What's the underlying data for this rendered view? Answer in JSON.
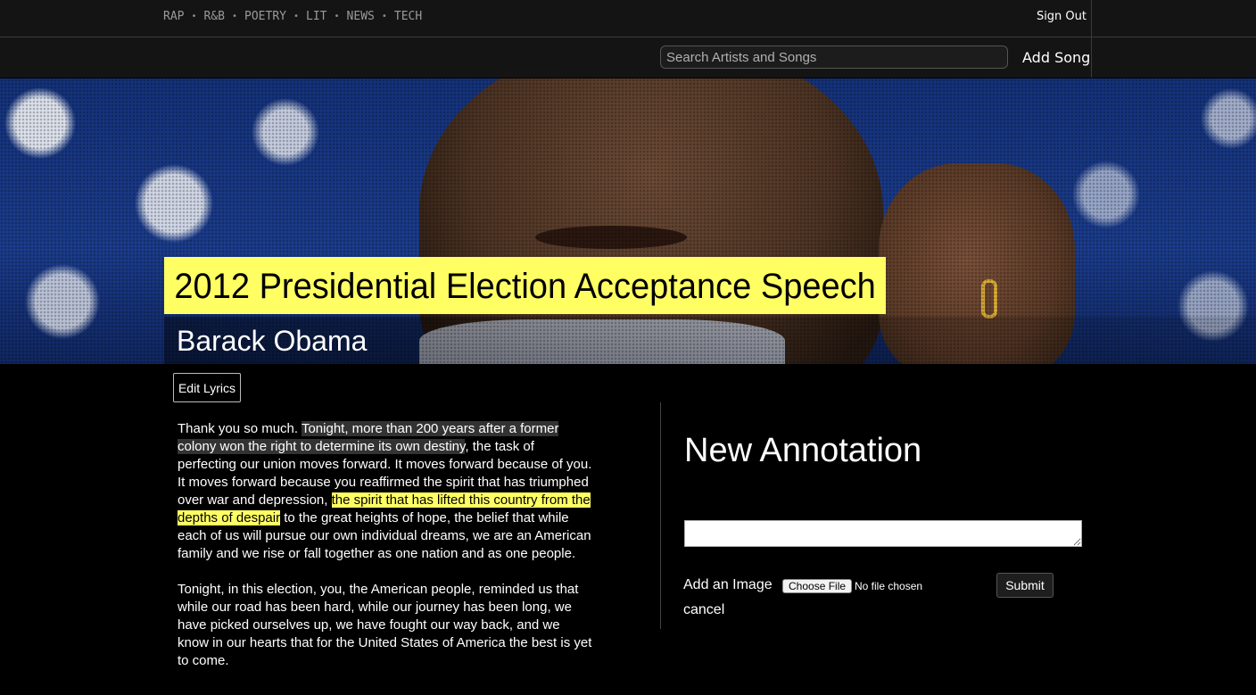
{
  "nav": {
    "genres": [
      "RAP",
      "R&B",
      "POETRY",
      "LIT",
      "NEWS",
      "TECH"
    ],
    "separator": "•",
    "sign_out": "Sign Out"
  },
  "search": {
    "placeholder": "Search Artists and Songs",
    "value": ""
  },
  "add_song": "Add Song",
  "song": {
    "title": "2012 Presidential Election Acceptance Speech",
    "artist": "Barack Obama",
    "edit_label": "Edit Lyrics"
  },
  "lyrics": {
    "p1": [
      {
        "text": "Thank you so much. ",
        "hl": ""
      },
      {
        "text": "Tonight, more than 200 years after a former colony won the right to determine its own destiny",
        "hl": "grey"
      },
      {
        "text": ", the task of perfecting our union moves forward. It moves forward because of you. It moves forward because you reaffirmed the spirit that has triumphed over war and depression, ",
        "hl": ""
      },
      {
        "text": "the spirit that has lifted this country from the depths of despair",
        "hl": "yellow"
      },
      {
        "text": " to the great heights of hope, the belief that while each of us will pursue our own individual dreams, we are an American family and we rise or fall together as one nation and as one people.",
        "hl": ""
      }
    ],
    "p2": "Tonight, in this election, you, the American people, reminded us that while our road has been hard, while our journey has been long, we have picked ourselves up, we have fought our way back, and we know in our hearts that for the United States of America the best is yet to come."
  },
  "annotation": {
    "title": "New Annotation",
    "text_value": "",
    "add_image_label": "Add an Image",
    "choose_file_label": "Choose File",
    "no_file_label": "No file chosen",
    "submit_label": "Submit",
    "cancel_label": "cancel"
  },
  "colors": {
    "highlight": "#ffff64",
    "selection": "#333333",
    "background": "#000000"
  }
}
